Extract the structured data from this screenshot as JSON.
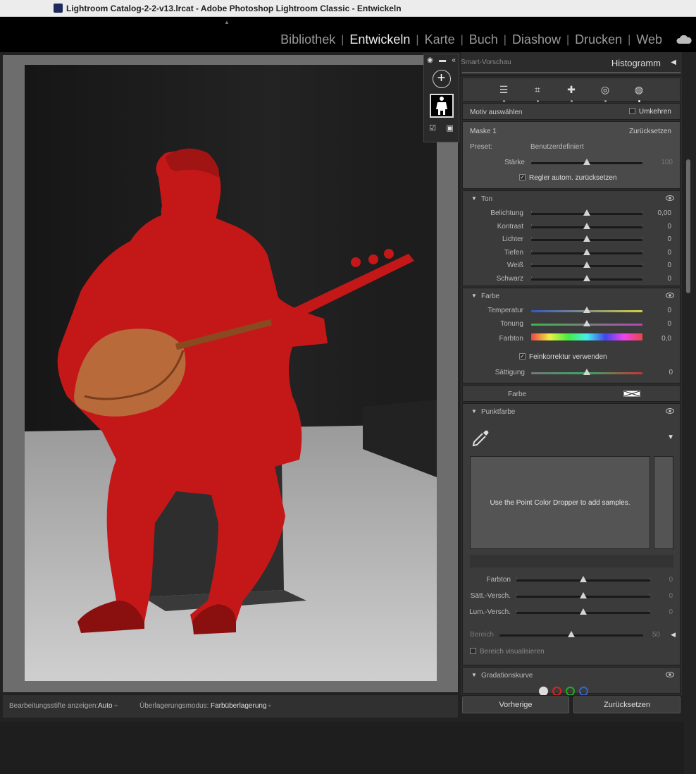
{
  "window": {
    "title": "Lightroom Catalog-2-2-v13.lrcat - Adobe Photoshop Lightroom Classic - Entwickeln"
  },
  "modules": [
    "Bibliothek",
    "Entwickeln",
    "Karte",
    "Buch",
    "Diashow",
    "Drucken",
    "Web"
  ],
  "active_module": "Entwickeln",
  "histogram": {
    "smart_preview": "Smart-Vorschau",
    "title": "Histogramm"
  },
  "mask": {
    "header": "Motiv auswählen",
    "invert": "Umkehren",
    "name": "Maske 1",
    "reset": "Zurücksetzen",
    "preset_label": "Preset:",
    "preset_value": "Benutzerdefiniert",
    "amount_label": "Stärke",
    "amount_value": "100",
    "auto_reset": "Regler autom. zurücksetzen"
  },
  "ton": {
    "title": "Ton",
    "sliders": [
      {
        "label": "Belichtung",
        "value": "0,00"
      },
      {
        "label": "Kontrast",
        "value": "0"
      },
      {
        "label": "Lichter",
        "value": "0"
      },
      {
        "label": "Tiefen",
        "value": "0"
      },
      {
        "label": "Weiß",
        "value": "0"
      },
      {
        "label": "Schwarz",
        "value": "0"
      }
    ]
  },
  "farbe": {
    "title": "Farbe",
    "temp_label": "Temperatur",
    "temp_value": "0",
    "tint_label": "Tonung",
    "tint_value": "0",
    "hue_label": "Farbton",
    "hue_value": "0,0",
    "fine": "Feinkorrektur verwenden",
    "sat_label": "Sättigung",
    "sat_value": "0",
    "color_label": "Farbe"
  },
  "punktfarbe": {
    "title": "Punktfarbe",
    "hint": "Use the Point Color Dropper to add samples.",
    "sliders": [
      {
        "label": "Farbton",
        "value": "0"
      },
      {
        "label": "Sätt.-Versch.",
        "value": "0"
      },
      {
        "label": "Lum.-Versch.",
        "value": "0"
      }
    ],
    "range_label": "Bereich",
    "range_value": "50",
    "visualize": "Bereich visualisieren"
  },
  "gradation": {
    "title": "Gradationskurve"
  },
  "footer": {
    "prev": "Vorherige",
    "reset": "Zurücksetzen"
  },
  "toolbar": {
    "pins_label": "Bearbeitungsstifte anzeigen:",
    "pins_value": "Auto",
    "overlay_label": "Überlagerungsmodus:",
    "overlay_value": "Farbüberlagerung"
  },
  "colors": {
    "overlay": "#c41818",
    "panel": "#3b3b3b",
    "accent": "#eeeeee"
  }
}
